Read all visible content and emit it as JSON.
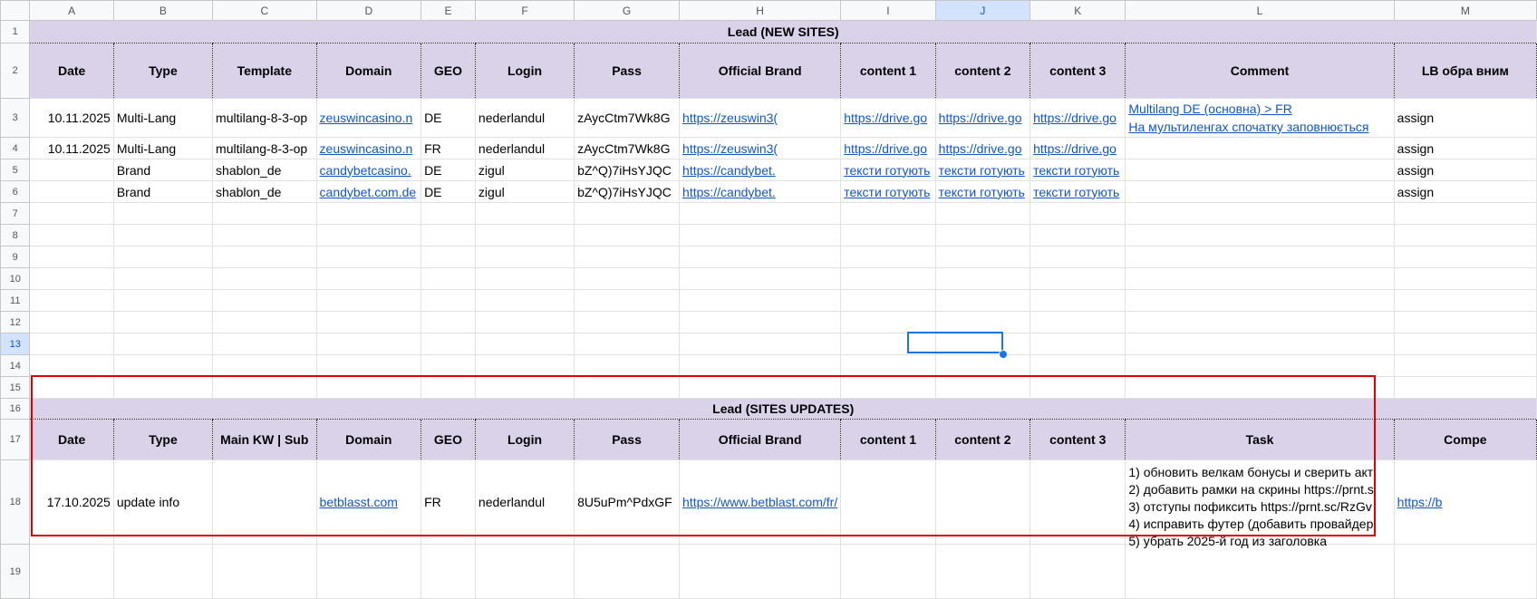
{
  "columns": [
    "A",
    "B",
    "C",
    "D",
    "E",
    "F",
    "G",
    "H",
    "I",
    "J",
    "K",
    "L",
    "M"
  ],
  "selected_cell": "J13",
  "new_sites": {
    "title": "Lead (NEW SITES)",
    "headers": [
      "Date",
      "Type",
      "Template",
      "Domain",
      "GEO",
      "Login",
      "Pass",
      "Official Brand",
      "content 1",
      "content 2",
      "content 3",
      "Comment",
      "LB обра вним"
    ],
    "rows": [
      [
        "10.11.2025",
        "Multi-Lang",
        "multilang-8-3-op",
        "zeuswincasino.n",
        "DE",
        "nederlandul",
        "zAycCtm7Wk8G",
        "https://zeuswin3(",
        "https://drive.go",
        "https://drive.go",
        "https://drive.go",
        "Multilang DE (основна) > FR\nНа мультиленгах спочатку заповнюється",
        "assign"
      ],
      [
        "10.11.2025",
        "Multi-Lang",
        "multilang-8-3-op",
        "zeuswincasino.n",
        "FR",
        "nederlandul",
        "zAycCtm7Wk8G",
        "https://zeuswin3(",
        "https://drive.go",
        "https://drive.go",
        "https://drive.go",
        "",
        "assign"
      ],
      [
        "",
        "Brand",
        "shablon_de",
        "candybetcasino.",
        "DE",
        "zigul",
        "bZ^Q)7iHsYJQC",
        "https://candybet.",
        "тексти готують",
        "тексти готують",
        "тексти готують",
        "",
        "assign"
      ],
      [
        "",
        "Brand",
        "shablon_de",
        "candybet.com.de",
        "DE",
        "zigul",
        "bZ^Q)7iHsYJQC",
        "https://candybet.",
        "тексти готують",
        "тексти готують",
        "тексти готують",
        "",
        "assign"
      ]
    ]
  },
  "updates": {
    "title": "Lead (SITES UPDATES)",
    "headers": [
      "Date",
      "Type",
      "Main KW | Sub",
      "Domain",
      "GEO",
      "Login",
      "Pass",
      "Official Brand",
      "content 1",
      "content 2",
      "content 3",
      "Task",
      "Compe"
    ],
    "rows": [
      [
        "17.10.2025",
        "update info",
        "",
        "betblasst.com",
        "FR",
        "nederlandul",
        "8U5uPm^PdxGF",
        "https://www.betblast.com/fr/",
        "",
        "",
        "",
        "1) обновить велкам бонусы и сверить акт\n2) добавить рамки на скрины https://prnt.s\n3) отступы пофиксить https://prnt.sc/RzGv\n4) исправить футер (добавить провайдер\n5) убрать 2025-й год из заголовка",
        "https://b"
      ]
    ]
  }
}
